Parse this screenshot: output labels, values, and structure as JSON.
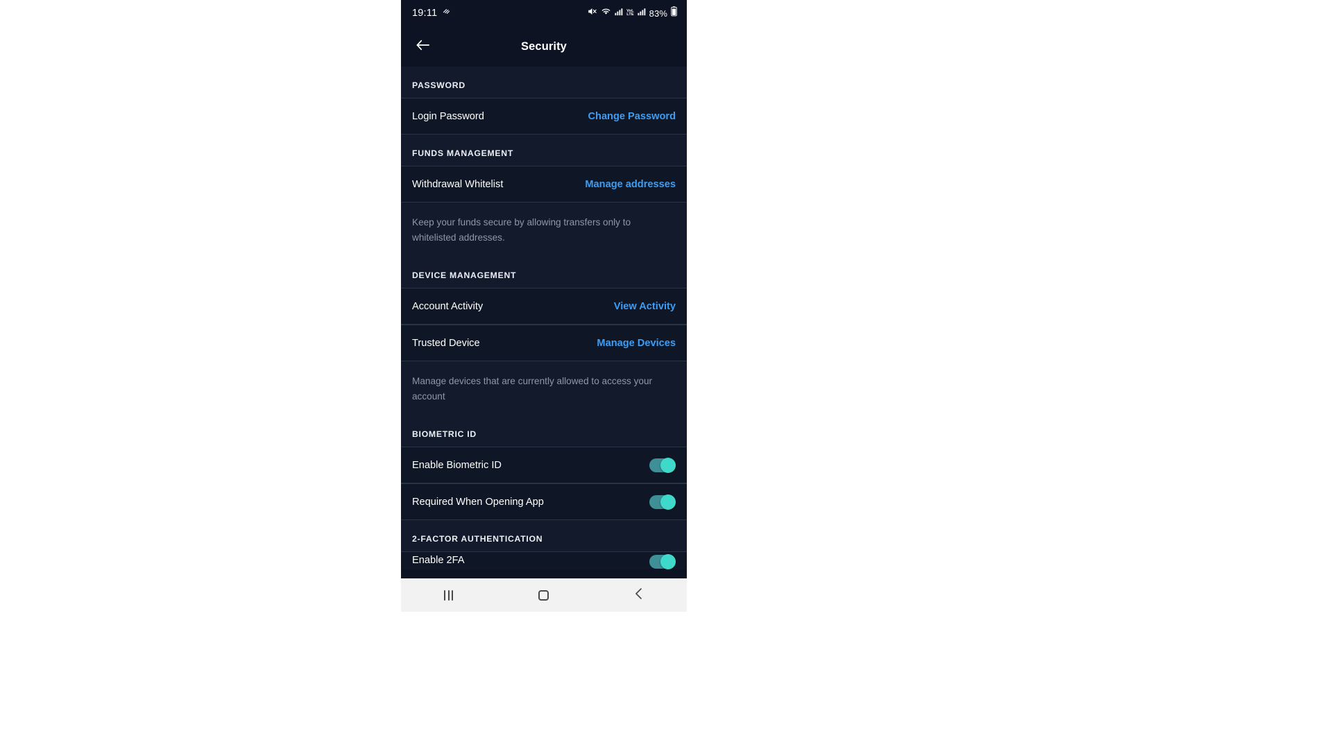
{
  "status_bar": {
    "time": "19:11",
    "battery_percent": "83%",
    "volte_top": "VoL",
    "volte_bottom": "LTE",
    "icons": [
      "mute-icon",
      "wifi-icon",
      "signal-icon",
      "volte-icon",
      "signal-bars-icon",
      "battery-icon"
    ]
  },
  "app_bar": {
    "title": "Security",
    "back_icon": "arrow-left-icon"
  },
  "sections": [
    {
      "header": "PASSWORD",
      "rows": [
        {
          "label": "Login Password",
          "action": "Change Password",
          "type": "link"
        }
      ],
      "helper": ""
    },
    {
      "header": "FUNDS MANAGEMENT",
      "rows": [
        {
          "label": "Withdrawal Whitelist",
          "action": "Manage addresses",
          "type": "link"
        }
      ],
      "helper": "Keep your funds secure by allowing transfers only to whitelisted addresses."
    },
    {
      "header": "DEVICE MANAGEMENT",
      "rows": [
        {
          "label": "Account Activity",
          "action": "View Activity",
          "type": "link"
        },
        {
          "label": "Trusted Device",
          "action": "Manage Devices",
          "type": "link"
        }
      ],
      "helper": "Manage devices that are currently allowed to access your account"
    },
    {
      "header": "BIOMETRIC ID",
      "rows": [
        {
          "label": "Enable Biometric ID",
          "action": "on",
          "type": "toggle"
        },
        {
          "label": "Required When Opening App",
          "action": "on",
          "type": "toggle"
        }
      ],
      "helper": ""
    },
    {
      "header": "2-FACTOR AUTHENTICATION",
      "rows": [
        {
          "label": "Enable 2FA",
          "action": "on",
          "type": "toggle"
        }
      ],
      "helper": ""
    }
  ],
  "nav_bar": {
    "recents_label": "recents",
    "home_label": "home",
    "back_label": "back"
  },
  "colors": {
    "background": "#0d1322",
    "row_background": "#0f1726",
    "section_background": "#121a2c",
    "link": "#3e9cf3",
    "toggle_on": "#3fd9cb",
    "helper_text": "#8e97a8",
    "divider": "#2a3447",
    "navbar": "#f2f2f2"
  }
}
